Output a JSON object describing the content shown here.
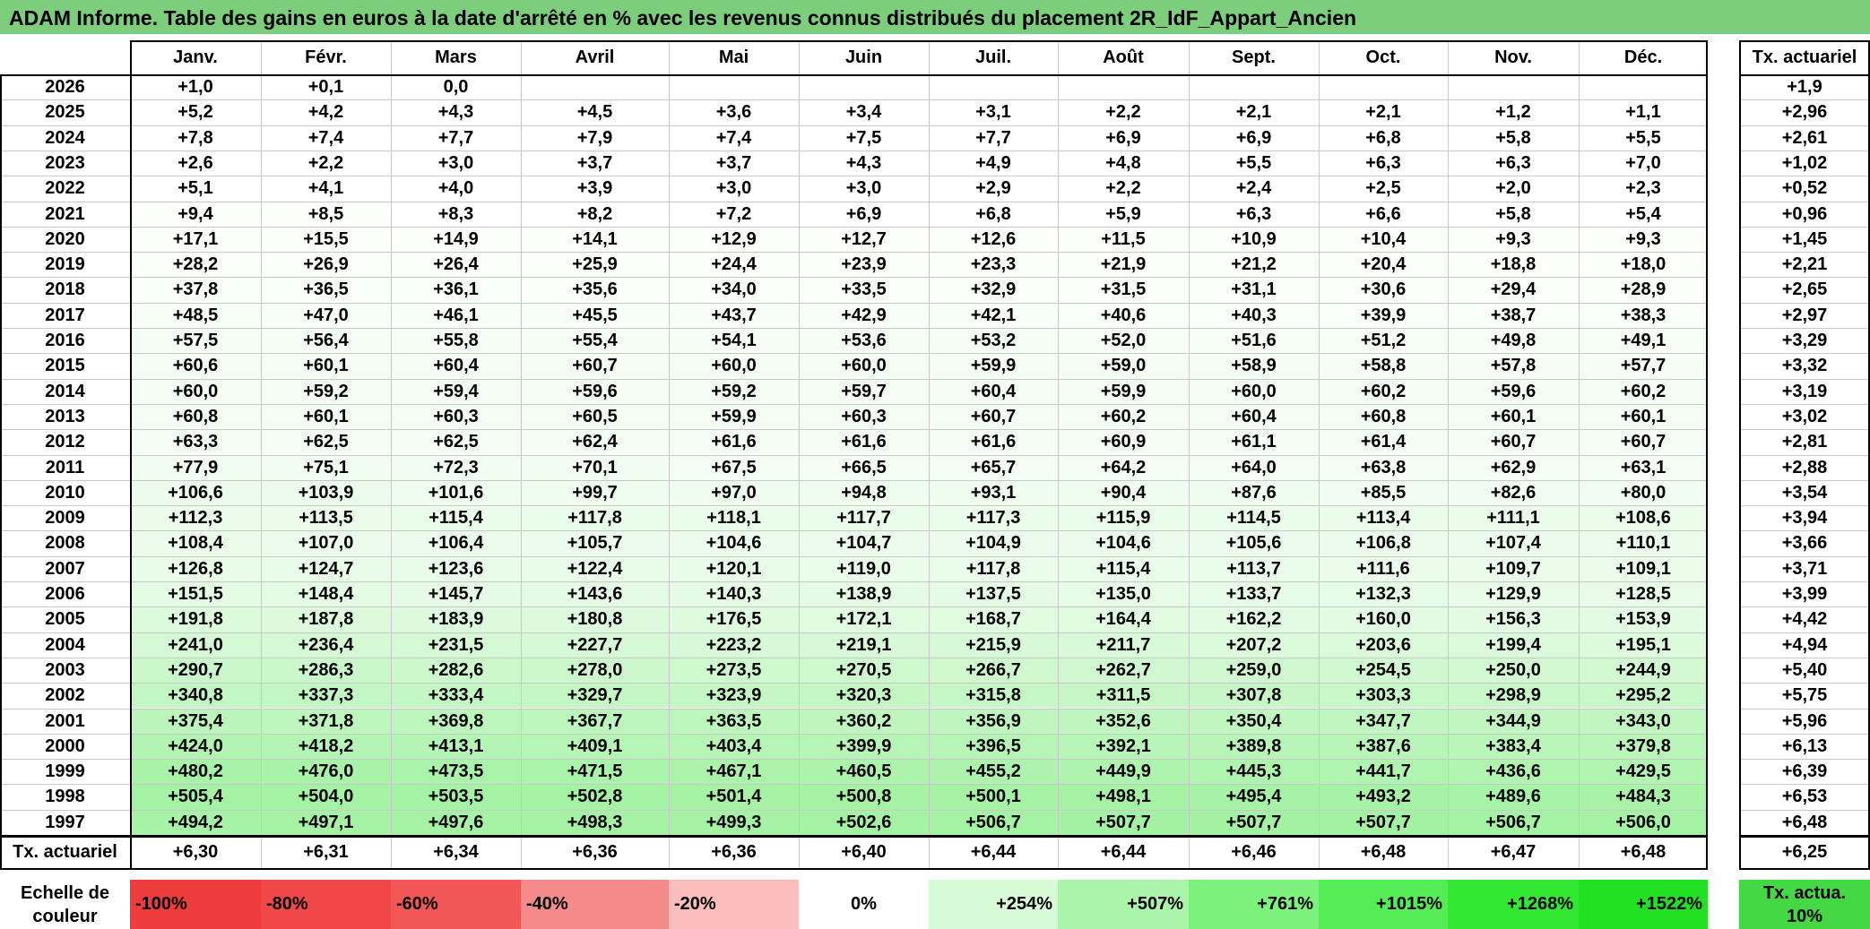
{
  "title": "ADAM Informe. Table des gains en euros à la date d'arrêté en % avec les revenus connus distribués du placement 2R_IdF_Appart_Ancien",
  "months": [
    "Janv.",
    "Févr.",
    "Mars",
    "Avril",
    "Mai",
    "Juin",
    "Juil.",
    "Août",
    "Sept.",
    "Oct.",
    "Nov.",
    "Déc."
  ],
  "rate_header": "Tx. actuariel",
  "rows": [
    {
      "year": "2026",
      "values": [
        "+1,0",
        "+0,1",
        "0,0",
        "",
        "",
        "",
        "",
        "",
        "",
        "",
        "",
        ""
      ],
      "rate": "+1,9"
    },
    {
      "year": "2025",
      "values": [
        "+5,2",
        "+4,2",
        "+4,3",
        "+4,5",
        "+3,6",
        "+3,4",
        "+3,1",
        "+2,2",
        "+2,1",
        "+2,1",
        "+1,2",
        "+1,1"
      ],
      "rate": "+2,96"
    },
    {
      "year": "2024",
      "values": [
        "+7,8",
        "+7,4",
        "+7,7",
        "+7,9",
        "+7,4",
        "+7,5",
        "+7,7",
        "+6,9",
        "+6,9",
        "+6,8",
        "+5,8",
        "+5,5"
      ],
      "rate": "+2,61"
    },
    {
      "year": "2023",
      "values": [
        "+2,6",
        "+2,2",
        "+3,0",
        "+3,7",
        "+3,7",
        "+4,3",
        "+4,9",
        "+4,8",
        "+5,5",
        "+6,3",
        "+6,3",
        "+7,0"
      ],
      "rate": "+1,02"
    },
    {
      "year": "2022",
      "values": [
        "+5,1",
        "+4,1",
        "+4,0",
        "+3,9",
        "+3,0",
        "+3,0",
        "+2,9",
        "+2,2",
        "+2,4",
        "+2,5",
        "+2,0",
        "+2,3"
      ],
      "rate": "+0,52"
    },
    {
      "year": "2021",
      "values": [
        "+9,4",
        "+8,5",
        "+8,3",
        "+8,2",
        "+7,2",
        "+6,9",
        "+6,8",
        "+5,9",
        "+6,3",
        "+6,6",
        "+5,8",
        "+5,4"
      ],
      "rate": "+0,96"
    },
    {
      "year": "2020",
      "values": [
        "+17,1",
        "+15,5",
        "+14,9",
        "+14,1",
        "+12,9",
        "+12,7",
        "+12,6",
        "+11,5",
        "+10,9",
        "+10,4",
        "+9,3",
        "+9,3"
      ],
      "rate": "+1,45"
    },
    {
      "year": "2019",
      "values": [
        "+28,2",
        "+26,9",
        "+26,4",
        "+25,9",
        "+24,4",
        "+23,9",
        "+23,3",
        "+21,9",
        "+21,2",
        "+20,4",
        "+18,8",
        "+18,0"
      ],
      "rate": "+2,21"
    },
    {
      "year": "2018",
      "values": [
        "+37,8",
        "+36,5",
        "+36,1",
        "+35,6",
        "+34,0",
        "+33,5",
        "+32,9",
        "+31,5",
        "+31,1",
        "+30,6",
        "+29,4",
        "+28,9"
      ],
      "rate": "+2,65"
    },
    {
      "year": "2017",
      "values": [
        "+48,5",
        "+47,0",
        "+46,1",
        "+45,5",
        "+43,7",
        "+42,9",
        "+42,1",
        "+40,6",
        "+40,3",
        "+39,9",
        "+38,7",
        "+38,3"
      ],
      "rate": "+2,97"
    },
    {
      "year": "2016",
      "values": [
        "+57,5",
        "+56,4",
        "+55,8",
        "+55,4",
        "+54,1",
        "+53,6",
        "+53,2",
        "+52,0",
        "+51,6",
        "+51,2",
        "+49,8",
        "+49,1"
      ],
      "rate": "+3,29"
    },
    {
      "year": "2015",
      "values": [
        "+60,6",
        "+60,1",
        "+60,4",
        "+60,7",
        "+60,0",
        "+60,0",
        "+59,9",
        "+59,0",
        "+58,9",
        "+58,8",
        "+57,8",
        "+57,7"
      ],
      "rate": "+3,32"
    },
    {
      "year": "2014",
      "values": [
        "+60,0",
        "+59,2",
        "+59,4",
        "+59,6",
        "+59,2",
        "+59,7",
        "+60,4",
        "+59,9",
        "+60,0",
        "+60,2",
        "+59,6",
        "+60,2"
      ],
      "rate": "+3,19"
    },
    {
      "year": "2013",
      "values": [
        "+60,8",
        "+60,1",
        "+60,3",
        "+60,5",
        "+59,9",
        "+60,3",
        "+60,7",
        "+60,2",
        "+60,4",
        "+60,8",
        "+60,1",
        "+60,1"
      ],
      "rate": "+3,02"
    },
    {
      "year": "2012",
      "values": [
        "+63,3",
        "+62,5",
        "+62,5",
        "+62,4",
        "+61,6",
        "+61,6",
        "+61,6",
        "+60,9",
        "+61,1",
        "+61,4",
        "+60,7",
        "+60,7"
      ],
      "rate": "+2,81"
    },
    {
      "year": "2011",
      "values": [
        "+77,9",
        "+75,1",
        "+72,3",
        "+70,1",
        "+67,5",
        "+66,5",
        "+65,7",
        "+64,2",
        "+64,0",
        "+63,8",
        "+62,9",
        "+63,1"
      ],
      "rate": "+2,88"
    },
    {
      "year": "2010",
      "values": [
        "+106,6",
        "+103,9",
        "+101,6",
        "+99,7",
        "+97,0",
        "+94,8",
        "+93,1",
        "+90,4",
        "+87,6",
        "+85,5",
        "+82,6",
        "+80,0"
      ],
      "rate": "+3,54"
    },
    {
      "year": "2009",
      "values": [
        "+112,3",
        "+113,5",
        "+115,4",
        "+117,8",
        "+118,1",
        "+117,7",
        "+117,3",
        "+115,9",
        "+114,5",
        "+113,4",
        "+111,1",
        "+108,6"
      ],
      "rate": "+3,94"
    },
    {
      "year": "2008",
      "values": [
        "+108,4",
        "+107,0",
        "+106,4",
        "+105,7",
        "+104,6",
        "+104,7",
        "+104,9",
        "+104,6",
        "+105,6",
        "+106,8",
        "+107,4",
        "+110,1"
      ],
      "rate": "+3,66"
    },
    {
      "year": "2007",
      "values": [
        "+126,8",
        "+124,7",
        "+123,6",
        "+122,4",
        "+120,1",
        "+119,0",
        "+117,8",
        "+115,4",
        "+113,7",
        "+111,6",
        "+109,7",
        "+109,1"
      ],
      "rate": "+3,71"
    },
    {
      "year": "2006",
      "values": [
        "+151,5",
        "+148,4",
        "+145,7",
        "+143,6",
        "+140,3",
        "+138,9",
        "+137,5",
        "+135,0",
        "+133,7",
        "+132,3",
        "+129,9",
        "+128,5"
      ],
      "rate": "+3,99"
    },
    {
      "year": "2005",
      "values": [
        "+191,8",
        "+187,8",
        "+183,9",
        "+180,8",
        "+176,5",
        "+172,1",
        "+168,7",
        "+164,4",
        "+162,2",
        "+160,0",
        "+156,3",
        "+153,9"
      ],
      "rate": "+4,42"
    },
    {
      "year": "2004",
      "values": [
        "+241,0",
        "+236,4",
        "+231,5",
        "+227,7",
        "+223,2",
        "+219,1",
        "+215,9",
        "+211,7",
        "+207,2",
        "+203,6",
        "+199,4",
        "+195,1"
      ],
      "rate": "+4,94"
    },
    {
      "year": "2003",
      "values": [
        "+290,7",
        "+286,3",
        "+282,6",
        "+278,0",
        "+273,5",
        "+270,5",
        "+266,7",
        "+262,7",
        "+259,0",
        "+254,5",
        "+250,0",
        "+244,9"
      ],
      "rate": "+5,40"
    },
    {
      "year": "2002",
      "values": [
        "+340,8",
        "+337,3",
        "+333,4",
        "+329,7",
        "+323,9",
        "+320,3",
        "+315,8",
        "+311,5",
        "+307,8",
        "+303,3",
        "+298,9",
        "+295,2"
      ],
      "rate": "+5,75"
    },
    {
      "year": "2001",
      "values": [
        "+375,4",
        "+371,8",
        "+369,8",
        "+367,7",
        "+363,5",
        "+360,2",
        "+356,9",
        "+352,6",
        "+350,4",
        "+347,7",
        "+344,9",
        "+343,0"
      ],
      "rate": "+5,96"
    },
    {
      "year": "2000",
      "values": [
        "+424,0",
        "+418,2",
        "+413,1",
        "+409,1",
        "+403,4",
        "+399,9",
        "+396,5",
        "+392,1",
        "+389,8",
        "+387,6",
        "+383,4",
        "+379,8"
      ],
      "rate": "+6,13"
    },
    {
      "year": "1999",
      "values": [
        "+480,2",
        "+476,0",
        "+473,5",
        "+471,5",
        "+467,1",
        "+460,5",
        "+455,2",
        "+449,9",
        "+445,3",
        "+441,7",
        "+436,6",
        "+429,5"
      ],
      "rate": "+6,39"
    },
    {
      "year": "1998",
      "values": [
        "+505,4",
        "+504,0",
        "+503,5",
        "+502,8",
        "+501,4",
        "+500,8",
        "+500,1",
        "+498,1",
        "+495,4",
        "+493,2",
        "+489,6",
        "+484,3"
      ],
      "rate": "+6,53"
    },
    {
      "year": "1997",
      "values": [
        "+494,2",
        "+497,1",
        "+497,6",
        "+498,3",
        "+499,3",
        "+502,6",
        "+506,7",
        "+507,7",
        "+507,7",
        "+507,7",
        "+506,7",
        "+506,0"
      ],
      "rate": "+6,48"
    }
  ],
  "footer": {
    "label": "Tx. actuariel",
    "values": [
      "+6,30",
      "+6,31",
      "+6,34",
      "+6,36",
      "+6,36",
      "+6,40",
      "+6,44",
      "+6,44",
      "+6,46",
      "+6,48",
      "+6,47",
      "+6,48"
    ],
    "rate": "+6,25"
  },
  "legend": {
    "label": "Echelle de couleur",
    "items": [
      {
        "text": "-100%",
        "color": "#ee3b3b"
      },
      {
        "text": "-80%",
        "color": "#f04848"
      },
      {
        "text": "-60%",
        "color": "#f25757"
      },
      {
        "text": "-40%",
        "color": "#f58a8a"
      },
      {
        "text": "-20%",
        "color": "#fbbcbc"
      },
      {
        "text": "0%",
        "color": "#ffffff"
      },
      {
        "text": "+254%",
        "color": "#d6fbd6"
      },
      {
        "text": "+507%",
        "color": "#aaf5aa"
      },
      {
        "text": "+761%",
        "color": "#7cf27c"
      },
      {
        "text": "+1015%",
        "color": "#55ed55"
      },
      {
        "text": "+1268%",
        "color": "#33e833"
      },
      {
        "text": "+1522%",
        "color": "#22e022"
      }
    ],
    "rate_legend": "Tx. actua. 10%",
    "rate_legend_color": "#44d844"
  },
  "colors": {
    "title_bg": "#7ccd7c",
    "scale_white": "#ffffff",
    "scale_max_green": "#a3f2a3"
  }
}
